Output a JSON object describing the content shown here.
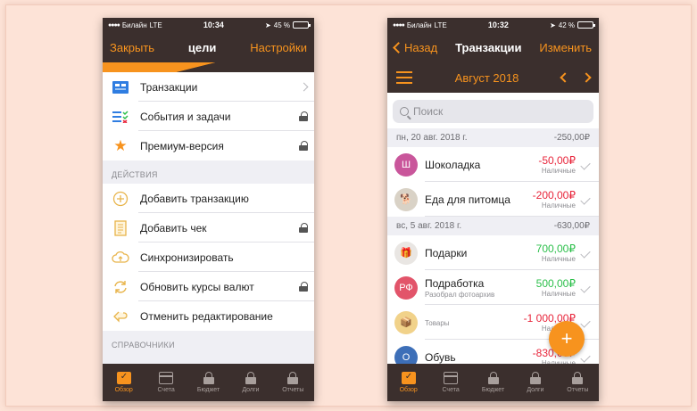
{
  "colors": {
    "accent": "#f7931e",
    "dark": "#3b2f2d",
    "negative": "#e8243a",
    "positive": "#2bbf4a"
  },
  "left": {
    "status": {
      "carrier": "Билайн",
      "network": "LTE",
      "time": "10:34",
      "battery": "45 %",
      "battery_level": 0.45
    },
    "nav": {
      "left": "Закрыть",
      "title": "цели",
      "right": "Настройки"
    },
    "main_items": [
      {
        "label": "Транзакции",
        "icon": "transactions-icon",
        "trail": "arrow"
      },
      {
        "label": "События и задачи",
        "icon": "tasks-icon",
        "trail": "lock"
      },
      {
        "label": "Премиум-версия",
        "icon": "star-icon",
        "trail": "lock"
      }
    ],
    "actions_header": "ДЕЙСТВИЯ",
    "actions": [
      {
        "label": "Добавить транзакцию",
        "icon": "plus-circle-icon",
        "trail": ""
      },
      {
        "label": "Добавить чек",
        "icon": "receipt-icon",
        "trail": "lock"
      },
      {
        "label": "Синхронизировать",
        "icon": "cloud-sync-icon",
        "trail": ""
      },
      {
        "label": "Обновить курсы валют",
        "icon": "refresh-icon",
        "trail": "lock"
      },
      {
        "label": "Отменить редактирование",
        "icon": "undo-icon",
        "trail": ""
      }
    ],
    "refs_header": "СПРАВОЧНИКИ",
    "tabs": [
      "Обзор",
      "Счета",
      "Бюджет",
      "Долги",
      "Отчеты"
    ]
  },
  "right": {
    "status": {
      "carrier": "Билайн",
      "network": "LTE",
      "time": "10:32",
      "battery": "42 %",
      "battery_level": 0.42
    },
    "nav": {
      "back": "Назад",
      "title": "Транзакции",
      "right": "Изменить"
    },
    "month": "Август 2018",
    "search_placeholder": "Поиск",
    "days": [
      {
        "date": "пн, 20 авг. 2018 г.",
        "total": "-250,00₽",
        "items": [
          {
            "avatar_text": "Ш",
            "avatar_color": "#c9569b",
            "name": "Шоколадка",
            "sub": "",
            "amount": "-50,00₽",
            "sign": "neg",
            "pay": "Наличные"
          },
          {
            "avatar_text": "🐕",
            "avatar_color": "#d9d2c6",
            "name": "Еда для питомца",
            "sub": "",
            "amount": "-200,00₽",
            "sign": "neg",
            "pay": "Наличные"
          }
        ]
      },
      {
        "date": "вс, 5 авг. 2018 г.",
        "total": "-630,00₽",
        "items": [
          {
            "avatar_text": "🎁",
            "avatar_color": "#e9e6e3",
            "name": "Подарки",
            "sub": "",
            "amount": "700,00₽",
            "sign": "pos",
            "pay": "Наличные"
          },
          {
            "avatar_text": "РФ",
            "avatar_color": "#e2546a",
            "name": "Подработка",
            "sub": "Разобрал фотоархив",
            "amount": "500,00₽",
            "sign": "pos",
            "pay": "Наличные"
          },
          {
            "avatar_text": "📦",
            "avatar_color": "#f1d28a",
            "name": "",
            "sub": "Товары",
            "amount": "-1 000,00₽",
            "sign": "neg",
            "pay": "Наличные"
          },
          {
            "avatar_text": "О",
            "avatar_color": "#3d6fb8",
            "name": "Обувь",
            "sub": "",
            "amount": "-830,00₽",
            "sign": "neg",
            "pay": "Наличные"
          }
        ]
      }
    ],
    "fab": "+",
    "tabs": [
      "Обзор",
      "Счета",
      "Бюджет",
      "Долги",
      "Отчеты"
    ]
  }
}
